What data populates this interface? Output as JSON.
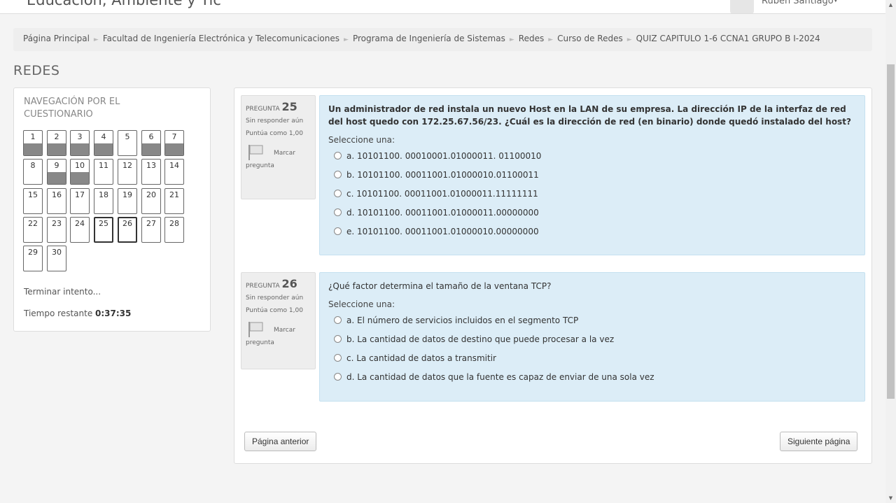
{
  "header": {
    "site_title": "Educación, Ambiente y Tic",
    "user_name": "Ruben Santiago",
    "user_menu_caret": "▼"
  },
  "breadcrumb": [
    "Página Principal",
    "Facultad de Ingeniería Electrónica y Telecomunicaciones",
    "Programa de Ingeniería de Sistemas",
    "Redes",
    "Curso de Redes",
    "QUIZ CAPITULO 1-6 CCNA1 GRUPO B I-2024"
  ],
  "breadcrumb_separator": "►",
  "page_heading": "REDES",
  "quiz_nav": {
    "title": "NAVEGACIÓN POR EL CUESTIONARIO",
    "questions": [
      {
        "n": "1",
        "answered": true,
        "current": false
      },
      {
        "n": "2",
        "answered": true,
        "current": false
      },
      {
        "n": "3",
        "answered": true,
        "current": false
      },
      {
        "n": "4",
        "answered": true,
        "current": false
      },
      {
        "n": "5",
        "answered": false,
        "current": false
      },
      {
        "n": "6",
        "answered": true,
        "current": false
      },
      {
        "n": "7",
        "answered": true,
        "current": false
      },
      {
        "n": "8",
        "answered": false,
        "current": false
      },
      {
        "n": "9",
        "answered": true,
        "current": false
      },
      {
        "n": "10",
        "answered": true,
        "current": false
      },
      {
        "n": "11",
        "answered": false,
        "current": false
      },
      {
        "n": "12",
        "answered": false,
        "current": false
      },
      {
        "n": "13",
        "answered": false,
        "current": false
      },
      {
        "n": "14",
        "answered": false,
        "current": false
      },
      {
        "n": "15",
        "answered": false,
        "current": false
      },
      {
        "n": "16",
        "answered": false,
        "current": false
      },
      {
        "n": "17",
        "answered": false,
        "current": false
      },
      {
        "n": "18",
        "answered": false,
        "current": false
      },
      {
        "n": "19",
        "answered": false,
        "current": false
      },
      {
        "n": "20",
        "answered": false,
        "current": false
      },
      {
        "n": "21",
        "answered": false,
        "current": false
      },
      {
        "n": "22",
        "answered": false,
        "current": false
      },
      {
        "n": "23",
        "answered": false,
        "current": false
      },
      {
        "n": "24",
        "answered": false,
        "current": false
      },
      {
        "n": "25",
        "answered": false,
        "current": true
      },
      {
        "n": "26",
        "answered": false,
        "current": true
      },
      {
        "n": "27",
        "answered": false,
        "current": false
      },
      {
        "n": "28",
        "answered": false,
        "current": false
      },
      {
        "n": "29",
        "answered": false,
        "current": false
      },
      {
        "n": "30",
        "answered": false,
        "current": false
      }
    ],
    "finish_link": "Terminar intento...",
    "time_label": "Tiempo restante",
    "time_value": "0:37:35"
  },
  "questions": [
    {
      "label": "PREGUNTA",
      "number": "25",
      "state": "Sin responder aún",
      "grade": "Puntúa como 1,00",
      "flag_label_1": "Marcar",
      "flag_label_2": "pregunta",
      "text": "Un administrador de red instala un nuevo Host en la LAN de su empresa. La dirección IP de la interfaz de red del host quedo con 172.25.67.56/23. ¿Cuál es la dirección de red (en binario) donde quedó instalado del host?",
      "prompt": "Seleccione una:",
      "answers": [
        "a. 10101100. 00010001.01000011. 01100010",
        "b. 10101100. 00011001.01000010.01100011",
        "c. 10101100. 00011001.01000011.11111111",
        "d. 10101100. 00011001.01000011.00000000",
        "e. 10101100. 00011001.01000010.00000000"
      ]
    },
    {
      "label": "PREGUNTA",
      "number": "26",
      "state": "Sin responder aún",
      "grade": "Puntúa como 1,00",
      "flag_label_1": "Marcar",
      "flag_label_2": "pregunta",
      "text": "¿Qué factor determina el tamaño de la ventana TCP?",
      "prompt": "Seleccione una:",
      "answers": [
        "a. El número de servicios incluidos en el segmento TCP",
        "b. La cantidad de datos de destino que puede procesar a la vez",
        "c. La cantidad de datos a transmitir",
        "d. La cantidad de datos que la fuente es capaz de enviar de una sola vez"
      ]
    }
  ],
  "buttons": {
    "previous": "Página anterior",
    "next": "Siguiente página"
  },
  "colors": {
    "question_bg": "#dcedf7",
    "info_bg": "#eeeeee",
    "answered_fill": "#888888"
  }
}
